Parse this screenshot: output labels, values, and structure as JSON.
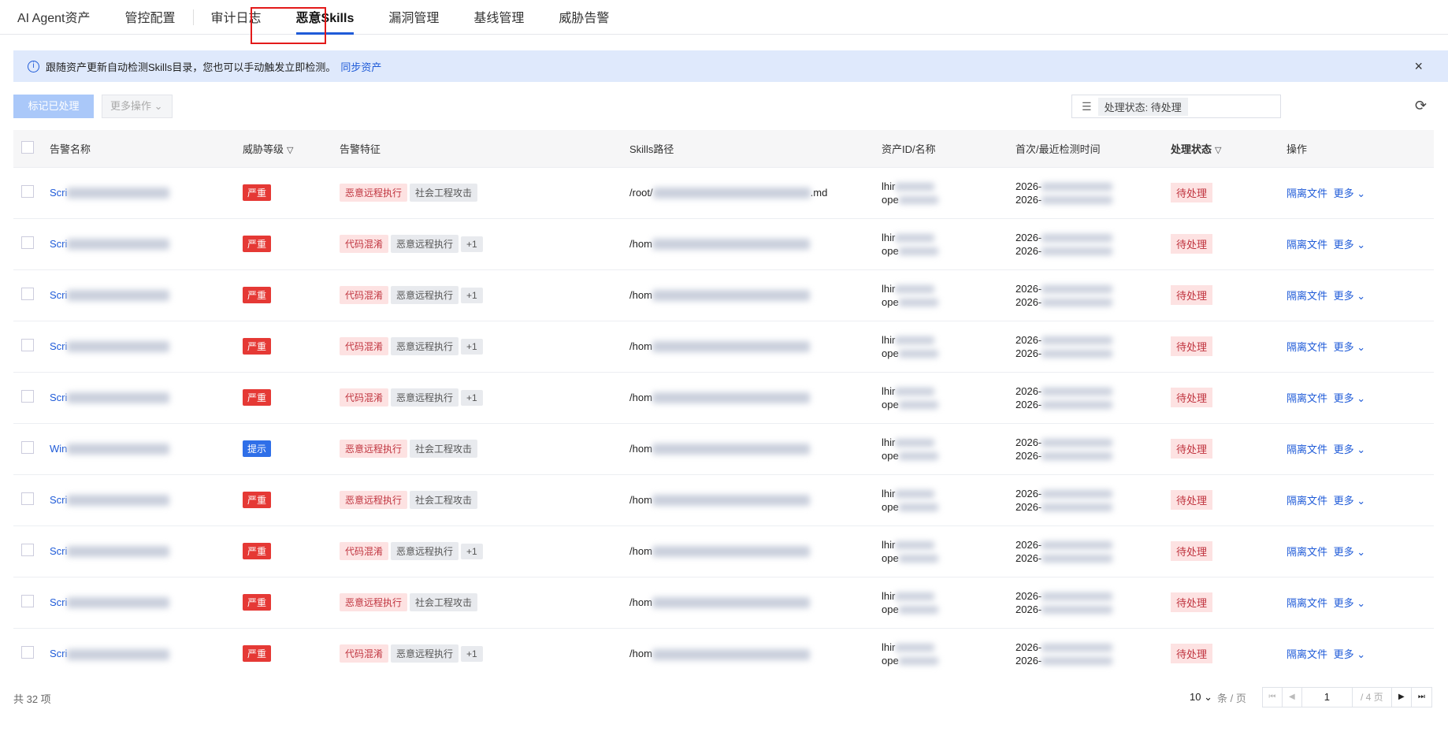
{
  "tabs": [
    "AI Agent资产",
    "管控配置",
    "审计日志",
    "恶意Skills",
    "漏洞管理",
    "基线管理",
    "威胁告警"
  ],
  "info": {
    "text": "跟随资产更新自动检测Skills目录，您也可以手动触发立即检测。",
    "link": "同步资产",
    "close": "×"
  },
  "toolbar": {
    "mark": "标记已处理",
    "more": "更多操作 ⌄",
    "filter_chip": "处理状态: 待处理"
  },
  "columns": [
    "告警名称",
    "威胁等级",
    "告警特征",
    "Skills路径",
    "资产ID/名称",
    "首次/最近检测时间",
    "处理状态",
    "操作"
  ],
  "rows": [
    {
      "name": "Scri",
      "level": "严重",
      "tags": [
        "恶意远程执行",
        "社会工程攻击"
      ],
      "path": "/root/",
      "path_end": ".md",
      "asset1": "lhir",
      "asset2": "ope",
      "t1": "2026-",
      "t2": "2026-",
      "status": "待处理",
      "act": "隔离文件",
      "more": "更多"
    },
    {
      "name": "Scri",
      "level": "严重",
      "tags": [
        "代码混淆",
        "恶意远程执行",
        "+1"
      ],
      "path": "/hom",
      "path_end": "",
      "asset1": "lhir",
      "asset2": "ope",
      "t1": "2026-",
      "t2": "2026-",
      "status": "待处理",
      "act": "隔离文件",
      "more": "更多"
    },
    {
      "name": "Scri",
      "level": "严重",
      "tags": [
        "代码混淆",
        "恶意远程执行",
        "+1"
      ],
      "path": "/hom",
      "path_end": "",
      "asset1": "lhir",
      "asset2": "ope",
      "t1": "2026-",
      "t2": "2026-",
      "status": "待处理",
      "act": "隔离文件",
      "more": "更多"
    },
    {
      "name": "Scri",
      "level": "严重",
      "tags": [
        "代码混淆",
        "恶意远程执行",
        "+1"
      ],
      "path": "/hom",
      "path_end": "",
      "asset1": "lhir",
      "asset2": "ope",
      "t1": "2026-",
      "t2": "2026-",
      "status": "待处理",
      "act": "隔离文件",
      "more": "更多"
    },
    {
      "name": "Scri",
      "level": "严重",
      "tags": [
        "代码混淆",
        "恶意远程执行",
        "+1"
      ],
      "path": "/hom",
      "path_end": "",
      "asset1": "lhir",
      "asset2": "ope",
      "t1": "2026-",
      "t2": "2026-",
      "status": "待处理",
      "act": "隔离文件",
      "more": "更多"
    },
    {
      "name": "Win",
      "level": "提示",
      "tags": [
        "恶意远程执行",
        "社会工程攻击"
      ],
      "path": "/hom",
      "path_end": "",
      "asset1": "lhir",
      "asset2": "ope",
      "t1": "2026-",
      "t2": "2026-",
      "status": "待处理",
      "act": "隔离文件",
      "more": "更多"
    },
    {
      "name": "Scri",
      "level": "严重",
      "tags": [
        "恶意远程执行",
        "社会工程攻击"
      ],
      "path": "/hom",
      "path_end": "",
      "asset1": "lhir",
      "asset2": "ope",
      "t1": "2026-",
      "t2": "2026-",
      "status": "待处理",
      "act": "隔离文件",
      "more": "更多"
    },
    {
      "name": "Scri",
      "level": "严重",
      "tags": [
        "代码混淆",
        "恶意远程执行",
        "+1"
      ],
      "path": "/hom",
      "path_end": "",
      "asset1": "lhir",
      "asset2": "ope",
      "t1": "2026-",
      "t2": "2026-",
      "status": "待处理",
      "act": "隔离文件",
      "more": "更多"
    },
    {
      "name": "Scri",
      "level": "严重",
      "tags": [
        "恶意远程执行",
        "社会工程攻击"
      ],
      "path": "/hom",
      "path_end": "",
      "asset1": "lhir",
      "asset2": "ope",
      "t1": "2026-",
      "t2": "2026-",
      "status": "待处理",
      "act": "隔离文件",
      "more": "更多"
    },
    {
      "name": "Scri",
      "level": "严重",
      "tags": [
        "代码混淆",
        "恶意远程执行",
        "+1"
      ],
      "path": "/hom",
      "path_end": "",
      "asset1": "lhir",
      "asset2": "ope",
      "t1": "2026-",
      "t2": "2026-",
      "status": "待处理",
      "act": "隔离文件",
      "more": "更多"
    }
  ],
  "footer": {
    "total": "共 32 项",
    "page_size": "10",
    "per_page": "条 / 页",
    "page": "1",
    "pages": "/ 4 页"
  },
  "colors": {
    "accent": "#1f5bd8",
    "severe": "#e53935",
    "hint": "#2f6fe8"
  }
}
